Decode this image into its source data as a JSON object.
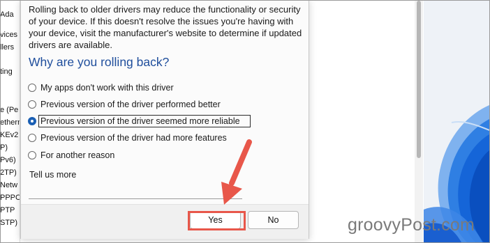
{
  "left_list": [
    "Ada",
    "vices",
    "llers",
    "ting",
    "e (Pe",
    "ethern",
    "KEv2",
    "P)",
    "Pv6)",
    "2TP)",
    "Netw",
    "PPPC",
    "PTP",
    "STP)"
  ],
  "dialog": {
    "intro_lines": [
      "Rolling back to older drivers may reduce the functionality or security",
      "of your device.  If this doesn't resolve the issues you're having with",
      "your device, visit the manufacturer's website to determine if updated",
      "drivers are available."
    ],
    "question": "Why are you rolling back?",
    "options": [
      {
        "label": "My apps don't work with this driver",
        "selected": false
      },
      {
        "label": "Previous version of the driver performed better",
        "selected": false
      },
      {
        "label": "Previous version of the driver seemed more reliable",
        "selected": true
      },
      {
        "label": "Previous version of the driver had more features",
        "selected": false
      },
      {
        "label": "For another reason",
        "selected": false
      }
    ],
    "tell_us_more_label": "Tell us more",
    "tell_us_more_value": "",
    "yes_label": "Yes",
    "no_label": "No"
  },
  "annotation": {
    "color": "#e8574a"
  },
  "watermark": "groovyPost.com",
  "colors": {
    "accent": "#1a5fb4",
    "heading": "#1f4e9c",
    "wallpaper_blue": "#1565d8"
  }
}
